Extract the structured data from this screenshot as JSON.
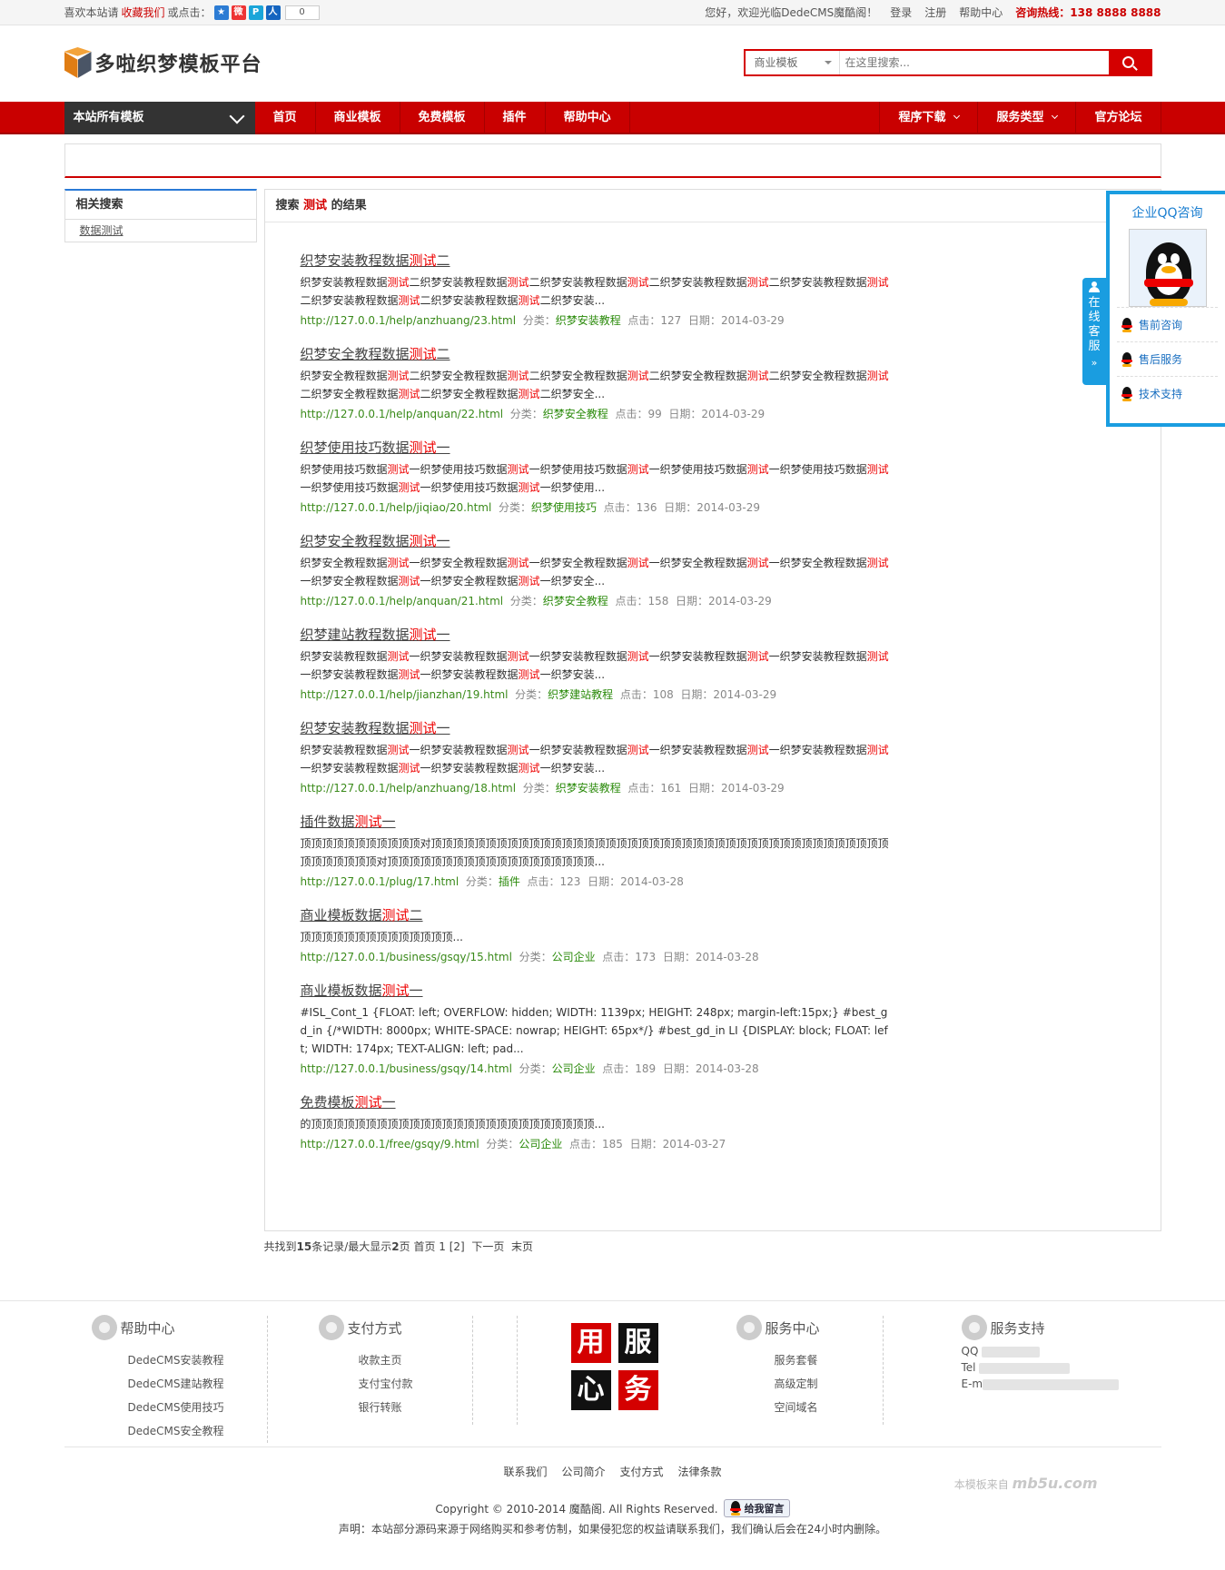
{
  "topbar": {
    "welcome_prefix": "喜欢本站请",
    "favorite": "收藏我们",
    "or_click": "或点击：",
    "share_count": "0",
    "greeting": "您好，欢迎光临DedeCMS魔酷阁！",
    "login": "登录",
    "register": "注册",
    "help": "帮助中心",
    "hotline": "咨询热线：138 8888 8888"
  },
  "header": {
    "logo_text": "多啦织梦模板平台",
    "search_select": "商业模板",
    "search_placeholder": "在这里搜索..."
  },
  "nav": {
    "all": "本站所有模板",
    "items": [
      "首页",
      "商业模板",
      "免费模板",
      "插件",
      "帮助中心"
    ],
    "right_items": [
      "程序下载",
      "服务类型",
      "官方论坛"
    ]
  },
  "sidebar": {
    "title": "相关搜索",
    "link": "数据测试"
  },
  "main": {
    "title_prefix": "搜索",
    "keyword": "测试",
    "title_suffix": "的结果"
  },
  "results": [
    {
      "title_a": "织梦安装教程数据",
      "title_b": "测试",
      "title_c": "二",
      "desc_html_parts": [
        "织梦安装教程数据",
        "测试",
        "二织梦安装教程数据",
        "测试",
        "二织梦安装教程数据",
        "测试",
        "二织梦安装教程数据",
        "测试",
        "二织梦安装教程数据",
        "测试",
        "二织梦安装教程数据",
        "测试",
        "二织梦安装教程数据",
        "测试",
        "二织梦安装..."
      ],
      "url": "http://127.0.0.1/help/anzhuang/23.html",
      "category": "织梦安装教程",
      "clicks": "127",
      "date": "2014-03-29"
    },
    {
      "title_a": "织梦安全教程数据",
      "title_b": "测试",
      "title_c": "二",
      "desc_html_parts": [
        "织梦安全教程数据",
        "测试",
        "二织梦安全教程数据",
        "测试",
        "二织梦安全教程数据",
        "测试",
        "二织梦安全教程数据",
        "测试",
        "二织梦安全教程数据",
        "测试",
        "二织梦安全教程数据",
        "测试",
        "二织梦安全教程数据",
        "测试",
        "二织梦安全..."
      ],
      "url": "http://127.0.0.1/help/anquan/22.html",
      "category": "织梦安全教程",
      "clicks": "99",
      "date": "2014-03-29"
    },
    {
      "title_a": "织梦使用技巧数据",
      "title_b": "测试",
      "title_c": "一",
      "desc_html_parts": [
        "织梦使用技巧数据",
        "测试",
        "一织梦使用技巧数据",
        "测试",
        "一织梦使用技巧数据",
        "测试",
        "一织梦使用技巧数据",
        "测试",
        "一织梦使用技巧数据",
        "测试",
        "一织梦使用技巧数据",
        "测试",
        "一织梦使用技巧数据",
        "测试",
        "一织梦使用..."
      ],
      "url": "http://127.0.0.1/help/jiqiao/20.html",
      "category": "织梦使用技巧",
      "clicks": "136",
      "date": "2014-03-29"
    },
    {
      "title_a": "织梦安全教程数据",
      "title_b": "测试",
      "title_c": "一",
      "desc_html_parts": [
        "织梦安全教程数据",
        "测试",
        "一织梦安全教程数据",
        "测试",
        "一织梦安全教程数据",
        "测试",
        "一织梦安全教程数据",
        "测试",
        "一织梦安全教程数据",
        "测试",
        "一织梦安全教程数据",
        "测试",
        "一织梦安全教程数据",
        "测试",
        "一织梦安全..."
      ],
      "url": "http://127.0.0.1/help/anquan/21.html",
      "category": "织梦安全教程",
      "clicks": "158",
      "date": "2014-03-29"
    },
    {
      "title_a": "织梦建站教程数据",
      "title_b": "测试",
      "title_c": "一",
      "desc_html_parts": [
        "织梦安装教程数据",
        "测试",
        "一织梦安装教程数据",
        "测试",
        "一织梦安装教程数据",
        "测试",
        "一织梦安装教程数据",
        "测试",
        "一织梦安装教程数据",
        "测试",
        "一织梦安装教程数据",
        "测试",
        "一织梦安装教程数据",
        "测试",
        "一织梦安装..."
      ],
      "url": "http://127.0.0.1/help/jianzhan/19.html",
      "category": "织梦建站教程",
      "clicks": "108",
      "date": "2014-03-29"
    },
    {
      "title_a": "织梦安装教程数据",
      "title_b": "测试",
      "title_c": "一",
      "desc_html_parts": [
        "织梦安装教程数据",
        "测试",
        "一织梦安装教程数据",
        "测试",
        "一织梦安装教程数据",
        "测试",
        "一织梦安装教程数据",
        "测试",
        "一织梦安装教程数据",
        "测试",
        "一织梦安装教程数据",
        "测试",
        "一织梦安装教程数据",
        "测试",
        "一织梦安装..."
      ],
      "url": "http://127.0.0.1/help/anzhuang/18.html",
      "category": "织梦安装教程",
      "clicks": "161",
      "date": "2014-03-29"
    },
    {
      "title_a": "插件数据",
      "title_b": "测试",
      "title_c": "一",
      "desc_html_parts": [
        "顶顶顶顶顶顶顶顶顶顶顶对顶顶顶顶顶顶顶顶顶顶顶顶顶顶顶顶顶顶顶顶顶顶顶顶顶顶顶顶顶顶顶顶顶顶顶顶顶顶顶顶顶顶顶顶顶顶顶顶顶对顶顶顶顶顶顶顶顶顶顶顶顶顶顶顶顶顶顶顶..."
      ],
      "url": "http://127.0.0.1/plug/17.html",
      "category": "插件",
      "clicks": "123",
      "date": "2014-03-28"
    },
    {
      "title_a": "商业模板数据",
      "title_b": "测试",
      "title_c": "二",
      "desc_html_parts": [
        "顶顶顶顶顶顶顶顶顶顶顶顶顶顶..."
      ],
      "url": "http://127.0.0.1/business/gsqy/15.html",
      "category": "公司企业",
      "clicks": "173",
      "date": "2014-03-28"
    },
    {
      "title_a": "商业模板数据",
      "title_b": "测试",
      "title_c": "一",
      "desc_html_parts": [
        "#ISL_Cont_1 {FLOAT: left; OVERFLOW: hidden; WIDTH: 1139px; HEIGHT: 248px; margin-left:15px;} #best_gd_in {/*WIDTH: 8000px; WHITE-SPACE: nowrap; HEIGHT: 65px*/} #best_gd_in LI {DISPLAY: block; FLOAT: left; WIDTH: 174px; TEXT-ALIGN: left; pad..."
      ],
      "url": "http://127.0.0.1/business/gsqy/14.html",
      "category": "公司企业",
      "clicks": "189",
      "date": "2014-03-28"
    },
    {
      "title_a": "免费模板",
      "title_b": "测试",
      "title_c": "一",
      "desc_html_parts": [
        "的顶顶顶顶顶顶顶顶顶顶顶顶顶顶顶顶顶顶顶顶顶顶顶顶顶顶..."
      ],
      "url": "http://127.0.0.1/free/gsqy/9.html",
      "category": "公司企业",
      "clicks": "185",
      "date": "2014-03-27"
    }
  ],
  "labels": {
    "category": "分类：",
    "clicks": "点击：",
    "date": "日期："
  },
  "pager": {
    "text_a": "共找到",
    "total": "15",
    "text_b": "条记录/最大显示",
    "pages": "2",
    "text_c": "页 首页 1 [2]",
    "next": "下一页",
    "last": "末页"
  },
  "qq": {
    "title": "企业QQ咨询",
    "tab": "在线客服",
    "rows": [
      "售前咨询",
      "售后服务",
      "技术支持"
    ]
  },
  "footer": {
    "help": {
      "title": "帮助中心",
      "links": [
        "DedeCMS安装教程",
        "DedeCMS建站教程",
        "DedeCMS使用技巧",
        "DedeCMS安全教程"
      ]
    },
    "pay": {
      "title": "支付方式",
      "links": [
        "收款主页",
        "支付宝付款",
        "银行转账"
      ]
    },
    "blocks": [
      "用",
      "服",
      "心",
      "务"
    ],
    "service": {
      "title": "服务中心",
      "links": [
        "服务套餐",
        "高级定制",
        "空间域名"
      ]
    },
    "support": {
      "title": "服务支持",
      "qq": "QQ",
      "tel": "Tel",
      "email": "E-m"
    },
    "bottom_links": [
      "联系我们",
      "公司简介",
      "支付方式",
      "法律条款"
    ],
    "copyright": "Copyright © 2010-2014 魔酷阁. All Rights Reserved.",
    "message_btn": "给我留言",
    "declaration": "声明：本站部分源码来源于网络购买和参考仿制，如果侵犯您的权益请联系我们，我们确认后会在24小时内删除。",
    "watermark_a": "本模板来自",
    "watermark_b": "mb5u.com"
  }
}
